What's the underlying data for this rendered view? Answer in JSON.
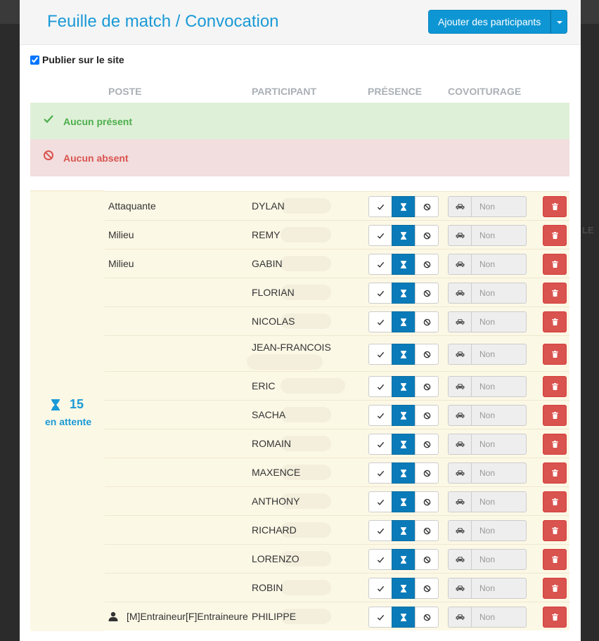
{
  "modal": {
    "title": "Feuille de match / Convocation",
    "add_button_label": "Ajouter des participants",
    "publish_label": "Publier sur le site",
    "publish_checked": true
  },
  "columns": {
    "poste": "POSTE",
    "participant": "PARTICIPANT",
    "presence": "PRÉSENCE",
    "covoiturage": "COVOITURAGE"
  },
  "groups": {
    "present_label": "Aucun présent",
    "absent_label": "Aucun absent",
    "waiting_count": "15",
    "waiting_label": "en attente"
  },
  "covoiturage_value": "Non",
  "participants": [
    {
      "poste": "Attaquante",
      "name": "DYLAN"
    },
    {
      "poste": "Milieu",
      "name": "REMY"
    },
    {
      "poste": "Milieu",
      "name": "GABIN"
    },
    {
      "poste": "",
      "name": "FLORIAN"
    },
    {
      "poste": "",
      "name": "NICOLAS"
    },
    {
      "poste": "",
      "name": "JEAN-FRANCOIS"
    },
    {
      "poste": "",
      "name": "ERIC"
    },
    {
      "poste": "",
      "name": "SACHA"
    },
    {
      "poste": "",
      "name": "ROMAIN"
    },
    {
      "poste": "",
      "name": "MAXENCE"
    },
    {
      "poste": "",
      "name": "ANTHONY"
    },
    {
      "poste": "",
      "name": "RICHARD"
    },
    {
      "poste": "",
      "name": "LORENZO"
    },
    {
      "poste": "",
      "name": "ROBIN"
    },
    {
      "poste": "[M]Entraineur[F]Entraineure",
      "name": "PHILIPPE",
      "poste_icon": "user-icon"
    }
  ],
  "background_page": {
    "right_fragment": "LE"
  },
  "colors": {
    "accent": "#1a9ad6",
    "button_primary": "#0e96d4",
    "active_presence": "#0a7bb8",
    "present_bg": "#dff0d8",
    "absent_bg": "#f2dede",
    "waiting_bg": "#fcf8e6",
    "delete": "#d9534f"
  },
  "icons": {
    "present": "check-icon",
    "waiting": "hourglass-icon",
    "absent": "ban-icon",
    "car": "car-icon",
    "delete": "trash-icon"
  }
}
